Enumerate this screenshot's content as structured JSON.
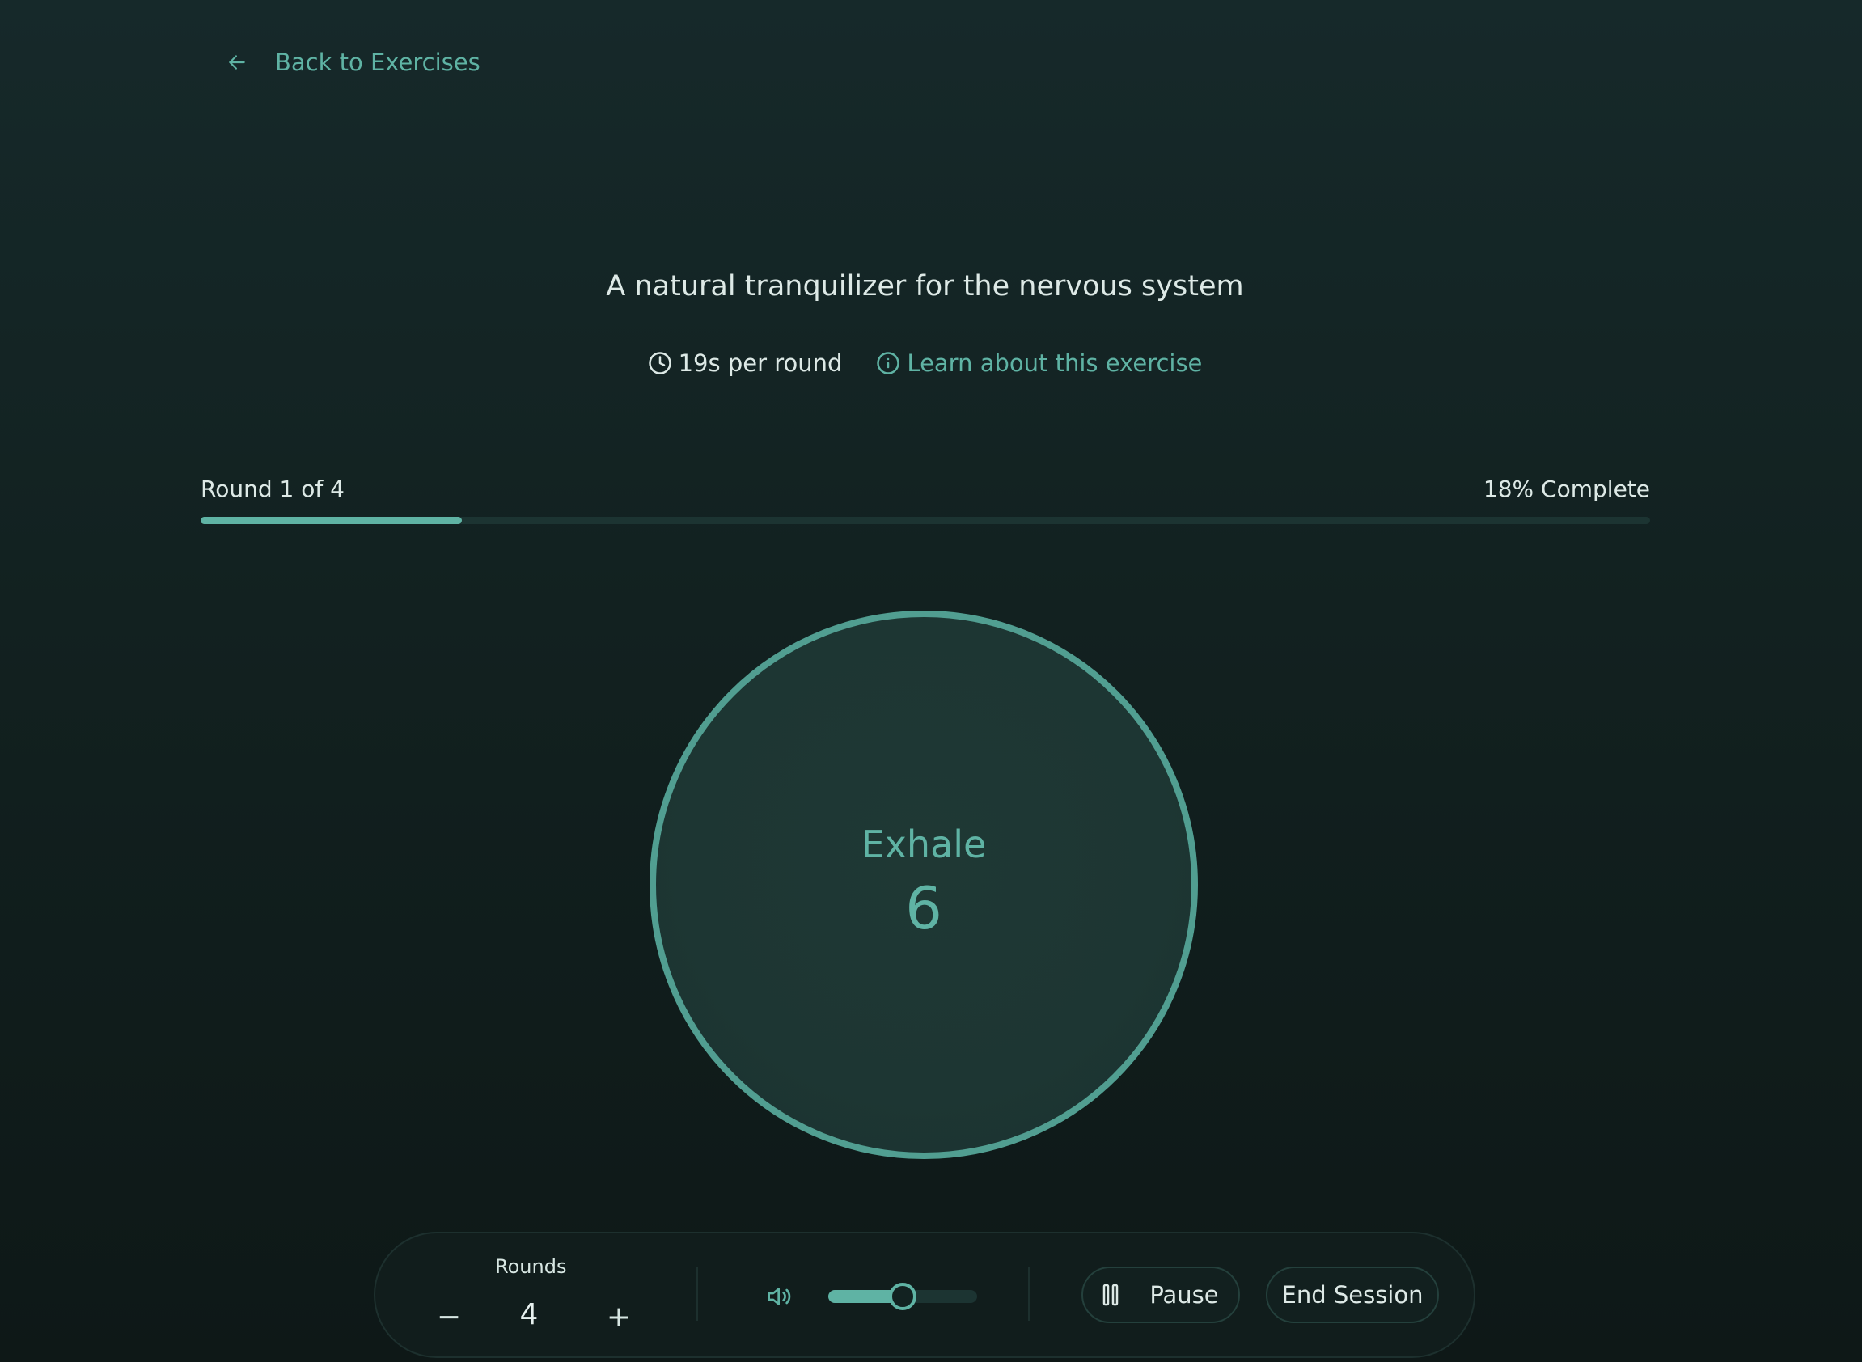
{
  "nav": {
    "back_label": "Back to Exercises"
  },
  "exercise": {
    "subtitle": "A natural tranquilizer for the nervous system",
    "duration_text": "19s per round",
    "learn_label": "Learn about this exercise"
  },
  "progress": {
    "round_text": "Round 1 of 4",
    "complete_text": "18% Complete",
    "percent": 18
  },
  "breath": {
    "phase": "Exhale",
    "count": "6"
  },
  "controls": {
    "rounds_label": "Rounds",
    "rounds_value": "4",
    "minus_symbol": "−",
    "plus_symbol": "+",
    "volume_level": 0.5,
    "pause_label": "Pause",
    "end_label": "End Session"
  },
  "colors": {
    "accent": "#5fb3a4",
    "circle_border": "#519e91",
    "background": "#122120"
  },
  "icons": {
    "back": "arrow-left-icon",
    "clock": "clock-icon",
    "info": "info-icon",
    "volume": "volume-icon",
    "pause": "pause-icon"
  }
}
